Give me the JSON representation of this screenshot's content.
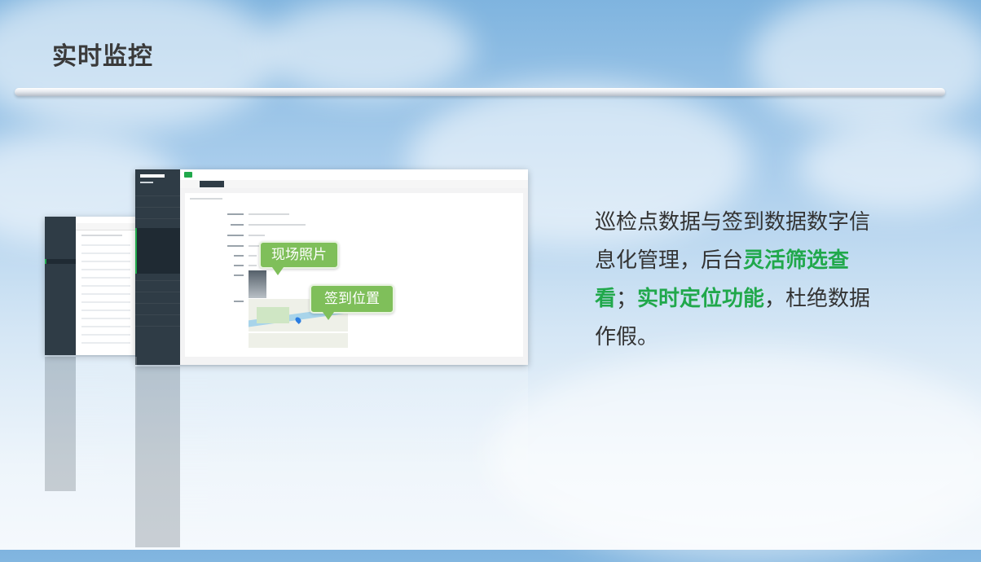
{
  "slide": {
    "title": "实时监控",
    "description": {
      "part1": "巡检点数据与签到数据数字信息化管理，后台",
      "hl1": "灵活筛选查看",
      "part2": "；",
      "hl2": "实时定位功能",
      "part3": "，杜绝数据作假。"
    },
    "colors": {
      "accent": "#20a84b",
      "bubble": "#7fbf5a",
      "sidebar": "#2f3c46"
    }
  },
  "callouts": {
    "photo": "现场照片",
    "location": "签到位置"
  }
}
